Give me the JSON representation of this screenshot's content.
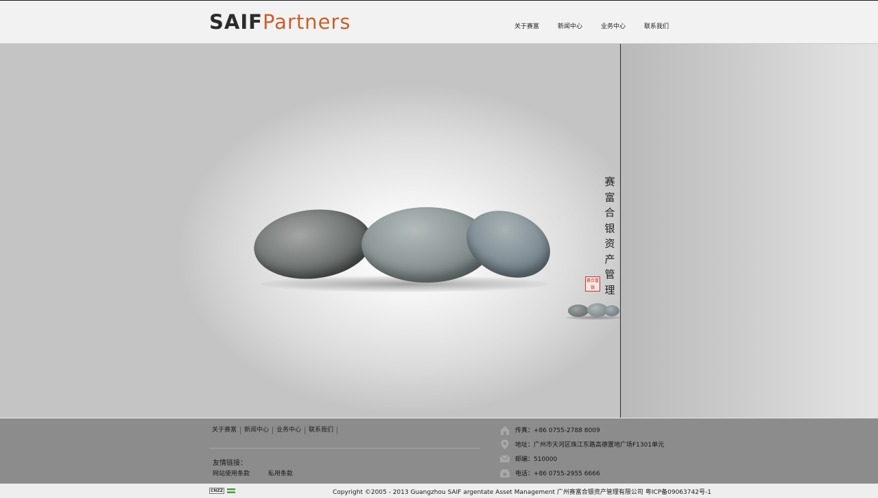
{
  "header": {
    "logo_main": "SAIF",
    "logo_accent": "Partners",
    "nav": [
      {
        "label": "关于赛富"
      },
      {
        "label": "新闻中心"
      },
      {
        "label": "业务中心"
      },
      {
        "label": "联系我们"
      }
    ]
  },
  "hero": {
    "calligraphy": "赛富合银资产管理",
    "seal_text": "赛合富银"
  },
  "footer": {
    "nav": [
      {
        "label": "关于赛富"
      },
      {
        "label": "新闻中心"
      },
      {
        "label": "业务中心"
      },
      {
        "label": "联系我们"
      }
    ],
    "links_title": "友情链接：",
    "links": [
      {
        "label": "网站使用条款"
      },
      {
        "label": "私用条款"
      }
    ],
    "contact": {
      "fax": "传真：+86 0755-2788 8009",
      "address": "地址：广州市天河区珠江东路高德置地广场F1301单元",
      "postcode": "邮编：510000",
      "phone": "电话：+86 0755-2955 6666"
    }
  },
  "copyright": {
    "badge": "CNZZ",
    "text": "Copyright ©2005 - 2013 Guangzhou SAIF argentate Asset Management 广州赛富合银资产管理有限公司   粤ICP备09063742号-1"
  },
  "colors": {
    "accent": "#c8602b",
    "logo_dark": "#2b2b2b",
    "footer_bg": "#8c8c8c"
  }
}
